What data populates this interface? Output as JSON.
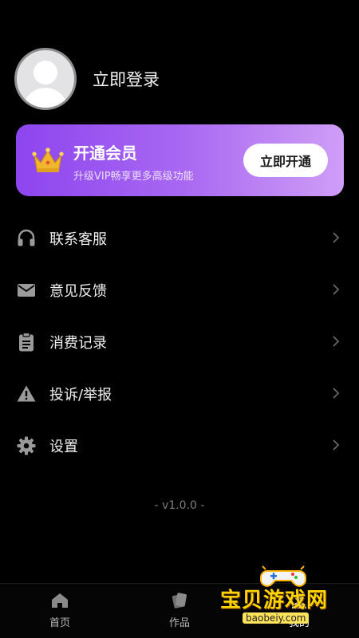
{
  "profile": {
    "login_label": "立即登录"
  },
  "vip": {
    "title": "开通会员",
    "subtitle": "升级VIP畅享更多高级功能",
    "button_label": "立即开通"
  },
  "menu": {
    "items": [
      {
        "label": "联系客服",
        "icon": "headset-icon"
      },
      {
        "label": "意见反馈",
        "icon": "mail-icon"
      },
      {
        "label": "消费记录",
        "icon": "clipboard-icon"
      },
      {
        "label": "投诉/举报",
        "icon": "warning-icon"
      },
      {
        "label": "设置",
        "icon": "gear-icon"
      }
    ]
  },
  "version": "- v1.0.0 -",
  "tabbar": {
    "tabs": [
      {
        "label": "首页",
        "icon": "home-icon"
      },
      {
        "label": "作品",
        "icon": "works-icon"
      },
      {
        "label": "我的",
        "icon": "user-icon",
        "active": true
      }
    ]
  },
  "watermark": {
    "text": "宝贝游戏网",
    "url": "baobeiy.com"
  },
  "colors": {
    "background": "#000000",
    "vip_gradient_start": "#8d45ee",
    "vip_gradient_end": "#cf9ef6"
  }
}
